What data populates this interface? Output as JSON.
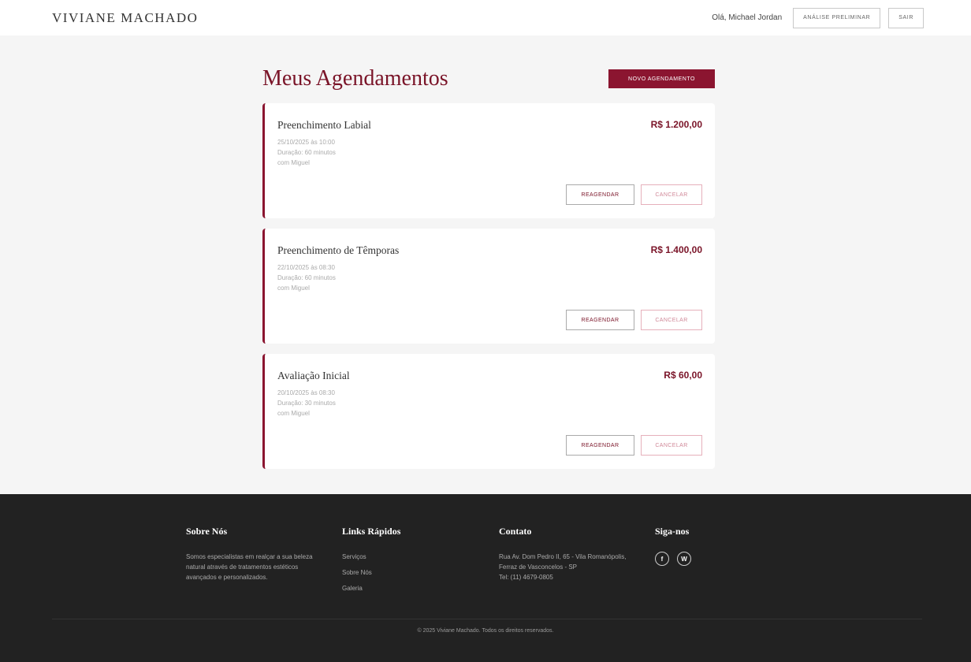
{
  "header": {
    "brand": "VIVIANE MACHADO",
    "greeting": "Olá, Michael Jordan",
    "analysis_label": "ANÁLISE PRELIMINAR",
    "logout_label": "SAIR"
  },
  "main": {
    "title": "Meus Agendamentos",
    "new_label": "NOVO AGENDAMENTO",
    "appointments": [
      {
        "service": "Preenchimento Labial",
        "price": "R$ 1.200,00",
        "datetime": "25/10/2025 às 10:00",
        "duration": "Duração: 60 minutos",
        "professional": "com Miguel",
        "reschedule_label": "REAGENDAR",
        "cancel_label": "CANCELAR"
      },
      {
        "service": "Preenchimento de Têmporas",
        "price": "R$ 1.400,00",
        "datetime": "22/10/2025 às 08:30",
        "duration": "Duração: 60 minutos",
        "professional": "com Miguel",
        "reschedule_label": "REAGENDAR",
        "cancel_label": "CANCELAR"
      },
      {
        "service": "Avaliação Inicial",
        "price": "R$ 60,00",
        "datetime": "20/10/2025 às 08:30",
        "duration": "Duração: 30 minutos",
        "professional": "com Miguel",
        "reschedule_label": "REAGENDAR",
        "cancel_label": "CANCELAR"
      }
    ]
  },
  "footer": {
    "about": {
      "title": "Sobre Nós",
      "text": "Somos especialistas em realçar a sua beleza natural através de tratamentos estéticos avançados e personalizados."
    },
    "links": {
      "title": "Links Rápidos",
      "items": [
        "Serviços",
        "Sobre Nós",
        "Galeria"
      ]
    },
    "contact": {
      "title": "Contato",
      "address": "Rua Av. Dom Pedro II, 65 - Vila Romanópolis, Ferraz de Vasconcelos - SP",
      "phone": "Tel: (11) 4679-0805"
    },
    "follow": {
      "title": "Siga-nos",
      "icons": [
        "facebook-icon",
        "whatsapp-icon"
      ],
      "facebook_glyph": "f",
      "whatsapp_glyph": "W"
    },
    "copyright": "© 2025 Viviane Machado. Todos os direitos reservados."
  },
  "colors": {
    "accent": "#8b1530",
    "footer_bg": "#222222",
    "page_bg": "#f5f5f5"
  }
}
